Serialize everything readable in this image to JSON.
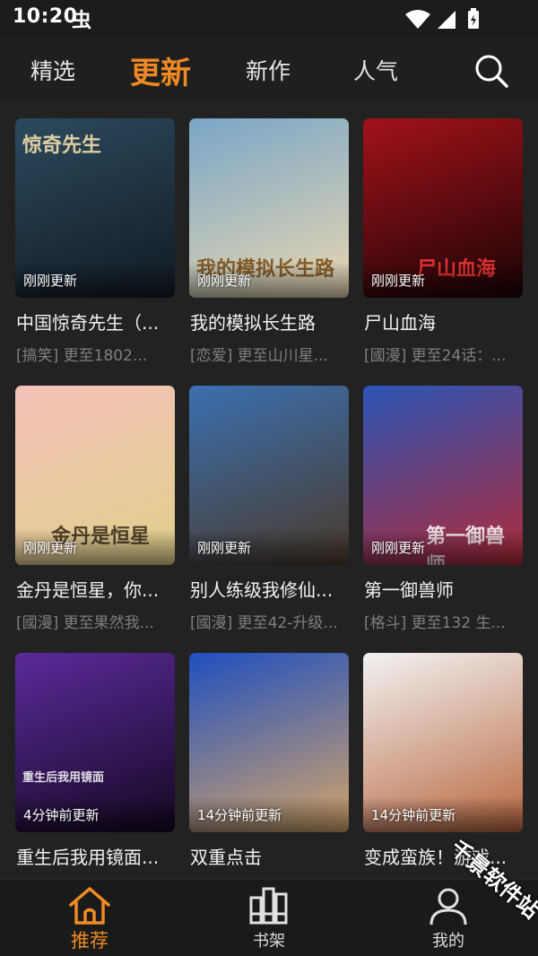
{
  "status_bar": {
    "time": "10:20",
    "bug_glyph": "虫"
  },
  "top_nav": {
    "tabs": [
      {
        "label": "精选",
        "active": false
      },
      {
        "label": "更新",
        "active": true
      },
      {
        "label": "新作",
        "active": false
      },
      {
        "label": "人气",
        "active": false
      }
    ],
    "search_icon": "search-icon"
  },
  "cards": [
    {
      "cover_text": "惊奇先生",
      "badge": "刚刚更新",
      "title": "中国惊奇先生（...",
      "subtitle": "[搞笑] 更至1802...",
      "cover_colors": [
        "#2c4a5e",
        "#111a22"
      ]
    },
    {
      "cover_text": "我的模拟长生路",
      "badge": "刚刚更新",
      "title": "我的模拟长生路",
      "subtitle": "[恋爱] 更至山川星...",
      "cover_colors": [
        "#7aa6c8",
        "#e8d7b0"
      ]
    },
    {
      "cover_text": "尸山血海",
      "badge": "刚刚更新",
      "title": "尸山血海",
      "subtitle": "[國漫] 更至24话：...",
      "cover_colors": [
        "#a3121a",
        "#1a0405"
      ]
    },
    {
      "cover_text": "金丹是恒星",
      "badge": "刚刚更新",
      "title": "金丹是恒星，你...",
      "subtitle": "[國漫] 更至果然我...",
      "cover_colors": [
        "#f4c1b9",
        "#e0d08a"
      ]
    },
    {
      "cover_text": "",
      "badge": "刚刚更新",
      "title": "别人练级我修仙...",
      "subtitle": "[國漫] 更至42-升级...",
      "cover_colors": [
        "#3b6fb0",
        "#4a3a2a"
      ]
    },
    {
      "cover_text": "第一御兽师",
      "badge": "刚刚更新",
      "title": "第一御兽师",
      "subtitle": "[格斗] 更至132 生...",
      "cover_colors": [
        "#2c55b5",
        "#b02b3a"
      ]
    },
    {
      "cover_text": "重生后我用镜面",
      "badge": "4分钟前更新",
      "title": "重生后我用镜面...",
      "subtitle": "",
      "cover_colors": [
        "#5b2a9a",
        "#140822"
      ]
    },
    {
      "cover_text": "",
      "badge": "14分钟前更新",
      "title": "双重点击",
      "subtitle": "",
      "cover_colors": [
        "#1f4fbf",
        "#d4a56a"
      ]
    },
    {
      "cover_text": "",
      "badge": "14分钟前更新",
      "title": "变成蛮族！游戏...",
      "subtitle": "",
      "cover_colors": [
        "#f2f2f2",
        "#b9673f"
      ]
    }
  ],
  "bottom_nav": [
    {
      "label": "推荐",
      "icon": "home-icon",
      "active": true
    },
    {
      "label": "书架",
      "icon": "bookshelf-icon",
      "active": false
    },
    {
      "label": "我的",
      "icon": "profile-icon",
      "active": false
    }
  ],
  "watermark": "千景软件站",
  "colors": {
    "accent": "#f08a24",
    "background": "#222222",
    "muted_text": "#7f7f7f"
  }
}
